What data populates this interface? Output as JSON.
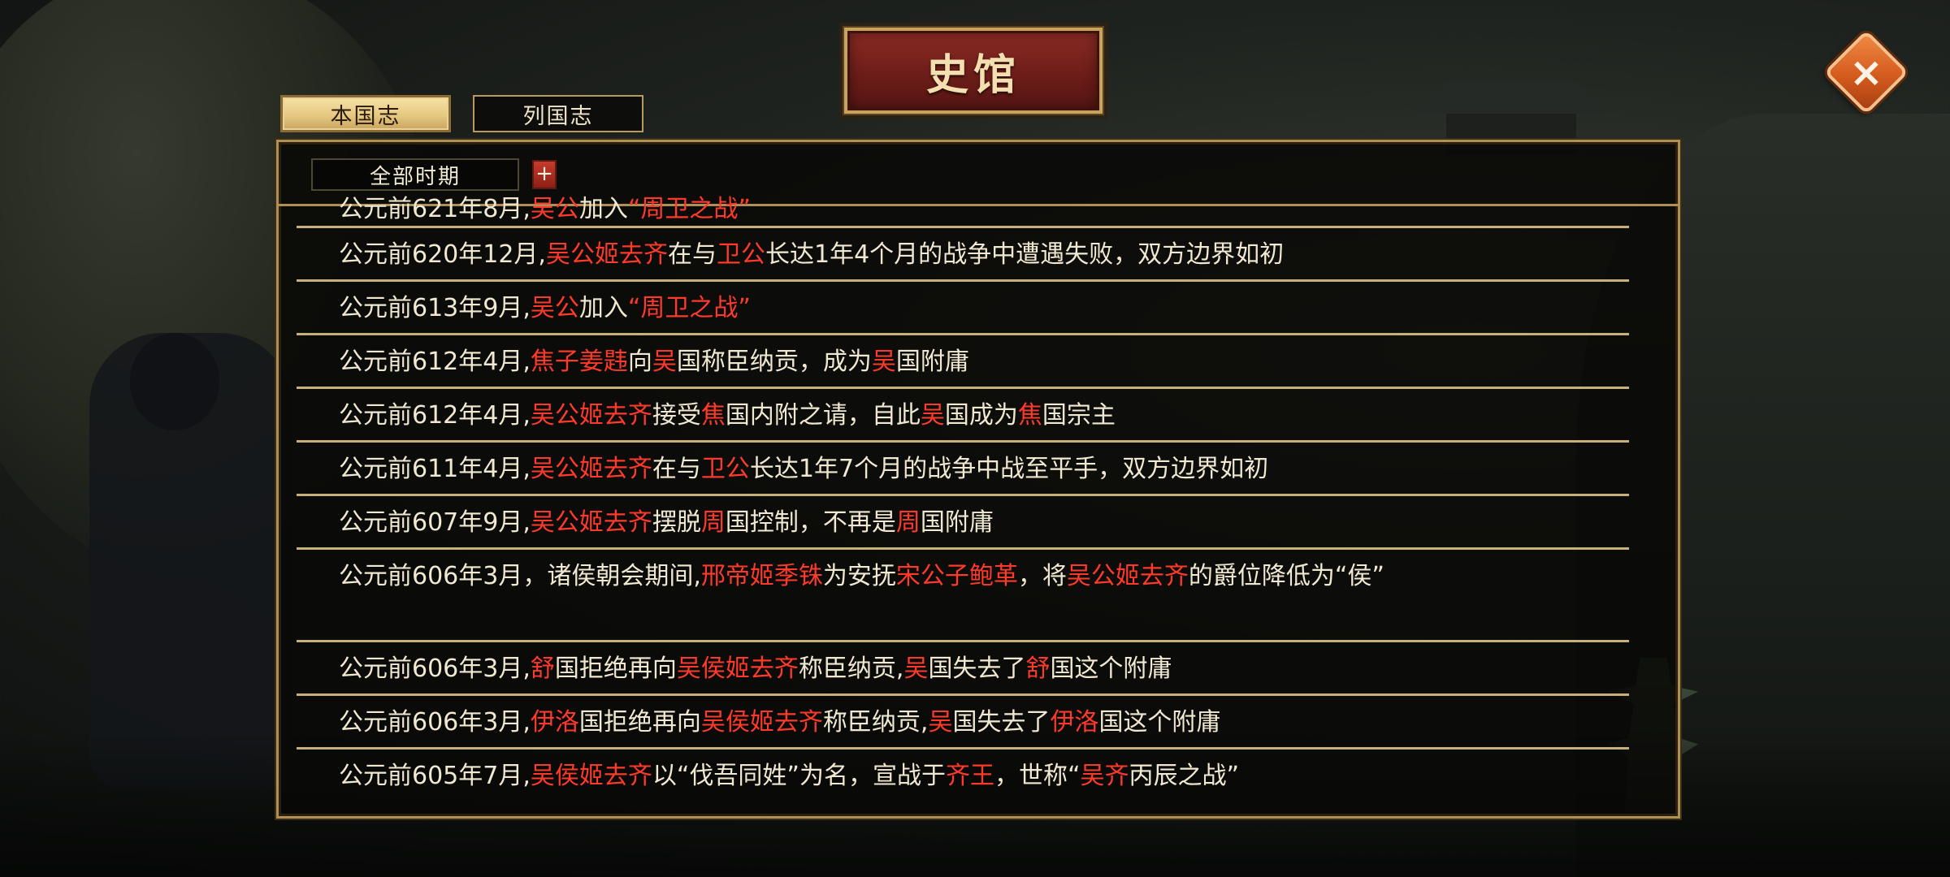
{
  "header": {
    "title": "史馆",
    "close_symbol": "×"
  },
  "tabs": [
    {
      "label": "本国志",
      "active": true
    },
    {
      "label": "列国志",
      "active": false
    }
  ],
  "filter": {
    "period_value": "全部时期",
    "expand_symbol": "+"
  },
  "colors": {
    "text": "#f1e8d2",
    "highlight": "#ff3a2a",
    "gold_border": "#c9a25c",
    "title_red": "#8c2b24"
  },
  "records": [
    {
      "segments": [
        {
          "t": "公元前621年8月,"
        },
        {
          "t": "吴公",
          "h": true
        },
        {
          "t": "加入"
        },
        {
          "t": "“周卫之战”",
          "h": true
        }
      ]
    },
    {
      "segments": [
        {
          "t": "公元前620年12月,"
        },
        {
          "t": "吴公姬去齐",
          "h": true
        },
        {
          "t": "在与"
        },
        {
          "t": "卫公",
          "h": true
        },
        {
          "t": "长达1年4个月的战争中遭遇失败，双方边界如初"
        }
      ]
    },
    {
      "segments": [
        {
          "t": "公元前613年9月,"
        },
        {
          "t": "吴公",
          "h": true
        },
        {
          "t": "加入"
        },
        {
          "t": "“周卫之战”",
          "h": true
        }
      ]
    },
    {
      "segments": [
        {
          "t": "公元前612年4月,"
        },
        {
          "t": "焦子姜韪",
          "h": true
        },
        {
          "t": "向"
        },
        {
          "t": "吴",
          "h": true
        },
        {
          "t": "国称臣纳贡，成为"
        },
        {
          "t": "吴",
          "h": true
        },
        {
          "t": "国附庸"
        }
      ]
    },
    {
      "segments": [
        {
          "t": "公元前612年4月,"
        },
        {
          "t": "吴公姬去齐",
          "h": true
        },
        {
          "t": "接受"
        },
        {
          "t": "焦",
          "h": true
        },
        {
          "t": "国内附之请，自此"
        },
        {
          "t": "吴",
          "h": true
        },
        {
          "t": "国成为"
        },
        {
          "t": "焦",
          "h": true
        },
        {
          "t": "国宗主"
        }
      ]
    },
    {
      "segments": [
        {
          "t": "公元前611年4月,"
        },
        {
          "t": "吴公姬去齐",
          "h": true
        },
        {
          "t": "在与"
        },
        {
          "t": "卫公",
          "h": true
        },
        {
          "t": "长达1年7个月的战争中战至平手，双方边界如初"
        }
      ]
    },
    {
      "segments": [
        {
          "t": "公元前607年9月,"
        },
        {
          "t": "吴公姬去齐",
          "h": true
        },
        {
          "t": "摆脱"
        },
        {
          "t": "周",
          "h": true
        },
        {
          "t": "国控制，不再是"
        },
        {
          "t": "周",
          "h": true
        },
        {
          "t": "国附庸"
        }
      ]
    },
    {
      "double": true,
      "segments": [
        {
          "t": "公元前606年3月，诸侯朝会期间,"
        },
        {
          "t": "邢帝姬季铢",
          "h": true
        },
        {
          "t": "为安抚"
        },
        {
          "t": "宋公子鲍革",
          "h": true
        },
        {
          "t": "，将"
        },
        {
          "t": "吴公姬去齐",
          "h": true
        },
        {
          "t": "的爵位降低为“侯”"
        }
      ]
    },
    {
      "segments": [
        {
          "t": "公元前606年3月,"
        },
        {
          "t": "舒",
          "h": true
        },
        {
          "t": "国拒绝再向"
        },
        {
          "t": "吴侯姬去齐",
          "h": true
        },
        {
          "t": "称臣纳贡,"
        },
        {
          "t": "吴",
          "h": true
        },
        {
          "t": "国失去了"
        },
        {
          "t": "舒",
          "h": true
        },
        {
          "t": "国这个附庸"
        }
      ]
    },
    {
      "segments": [
        {
          "t": "公元前606年3月,"
        },
        {
          "t": "伊洛",
          "h": true
        },
        {
          "t": "国拒绝再向"
        },
        {
          "t": "吴侯姬去齐",
          "h": true
        },
        {
          "t": "称臣纳贡,"
        },
        {
          "t": "吴",
          "h": true
        },
        {
          "t": "国失去了"
        },
        {
          "t": "伊洛",
          "h": true
        },
        {
          "t": "国这个附庸"
        }
      ]
    },
    {
      "segments": [
        {
          "t": "公元前605年7月,"
        },
        {
          "t": "吴侯姬去齐",
          "h": true
        },
        {
          "t": "以“伐吾同姓”为名，宣战于"
        },
        {
          "t": "齐王",
          "h": true
        },
        {
          "t": "，世称“"
        },
        {
          "t": "吴齐",
          "h": true
        },
        {
          "t": "丙辰之战”"
        }
      ]
    }
  ]
}
